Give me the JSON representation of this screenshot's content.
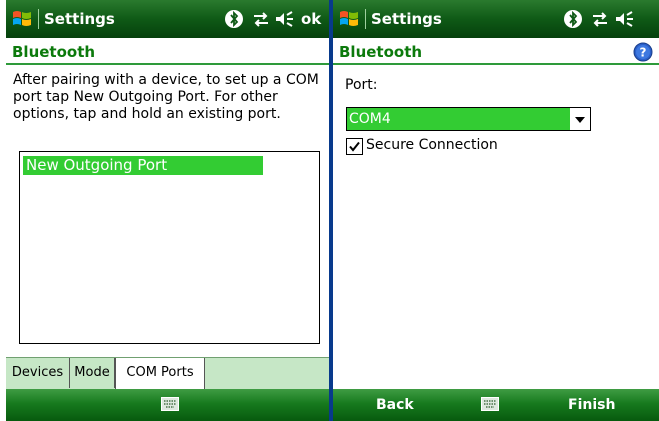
{
  "left_screen": {
    "title": "Settings",
    "ok_label": "ok",
    "section_title": "Bluetooth",
    "description": "After pairing with a device, to set up a COM port tap New Outgoing Port. For other options, tap and hold an existing port.",
    "ports": [
      "New Outgoing Port"
    ],
    "tabs": [
      {
        "label": "Devices"
      },
      {
        "label": "Mode"
      },
      {
        "label": "COM Ports",
        "active": true
      }
    ]
  },
  "right_screen": {
    "title": "Settings",
    "section_title": "Bluetooth",
    "port_label": "Port:",
    "port_value": "COM4",
    "secure_label": "Secure Connection",
    "secure_checked": true,
    "softkey_left": "Back",
    "softkey_right": "Finish"
  },
  "colors": {
    "titlebar": "#0f5a16",
    "accent_green": "#33cc33",
    "section_text": "#0c7a0c",
    "frame": "#083a8c"
  },
  "icons": [
    "windows-start-icon",
    "bluetooth-icon",
    "connectivity-icon",
    "volume-icon",
    "help-icon",
    "keyboard-icon",
    "dropdown-arrow-icon",
    "checkmark-icon"
  ]
}
